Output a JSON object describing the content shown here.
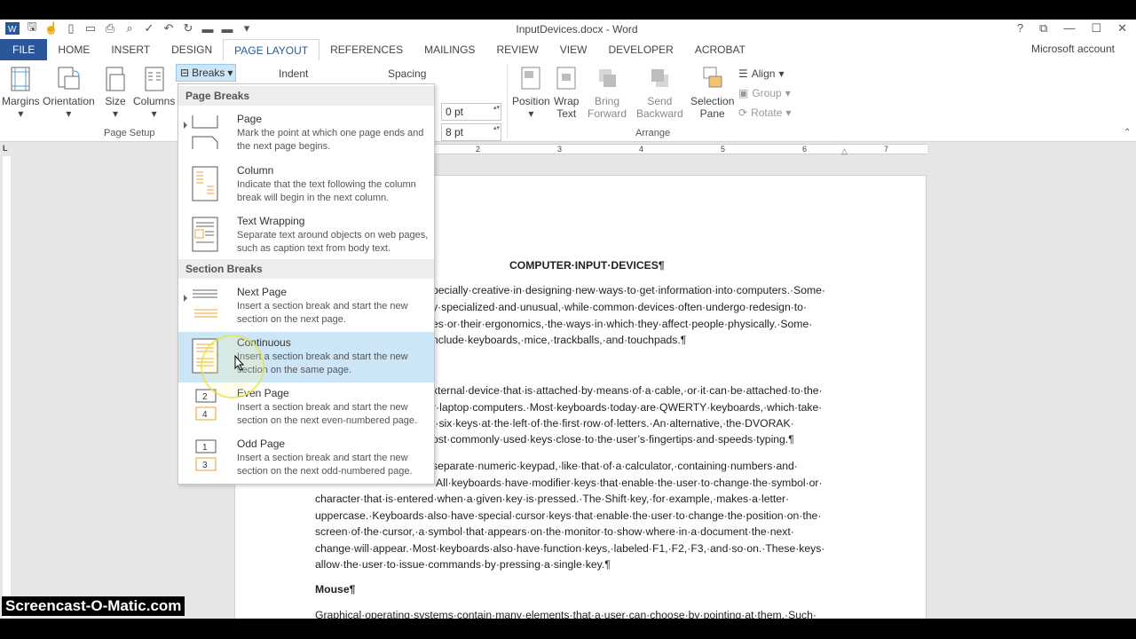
{
  "window": {
    "title": "InputDevices.docx - Word",
    "controls": [
      "?",
      "⧉",
      "—",
      "☐",
      "✕"
    ]
  },
  "tabs": [
    {
      "label": "FILE"
    },
    {
      "label": "HOME"
    },
    {
      "label": "INSERT"
    },
    {
      "label": "DESIGN"
    },
    {
      "label": "PAGE LAYOUT"
    },
    {
      "label": "REFERENCES"
    },
    {
      "label": "MAILINGS"
    },
    {
      "label": "REVIEW"
    },
    {
      "label": "VIEW"
    },
    {
      "label": "DEVELOPER"
    },
    {
      "label": "ACROBAT"
    }
  ],
  "account": "Microsoft account",
  "ribbon": {
    "page_setup": {
      "margins": "Margins",
      "orientation": "Orientation",
      "size": "Size",
      "columns": "Columns",
      "group": "Page Setup"
    },
    "breaks": "Breaks",
    "indent": "Indent",
    "spacing": {
      "label": "Spacing",
      "before": "0 pt",
      "after": "8 pt"
    },
    "arrange": {
      "position": "Position",
      "wrap_text": "Wrap\nText",
      "bring_forward": "Bring\nForward",
      "send_backward": "Send\nBackward",
      "selection_pane": "Selection\nPane",
      "align": "Align",
      "group": "Group",
      "rotate": "Rotate",
      "group_label": "Arrange"
    }
  },
  "ruler": [
    "2",
    "3",
    "4",
    "5",
    "6",
    "7"
  ],
  "dropdown": {
    "page_breaks_heading": "Page Breaks",
    "section_breaks_heading": "Section Breaks",
    "items": [
      {
        "title": "Page",
        "desc": "Mark the point at which one page ends and the next page begins."
      },
      {
        "title": "Column",
        "desc": "Indicate that the text following the column break will begin in the next column."
      },
      {
        "title": "Text Wrapping",
        "desc": "Separate text around objects on web pages, such as caption text from body text."
      },
      {
        "title": "Next Page",
        "desc": "Insert a section break and start the new section on the next page."
      },
      {
        "title": "Continuous",
        "desc": "Insert a section break and start the new section on the same page."
      },
      {
        "title": "Even Page",
        "desc": "Insert a section break and start the new section on the next even-numbered page."
      },
      {
        "title": "Odd Page",
        "desc": "Insert a section break and start the new section on the next odd-numbered page."
      }
    ]
  },
  "document": {
    "heading": "COMPUTER·INPUT·DEVICES¶",
    "p1": [
      "pecially·creative·in·designing·new·ways·to·get·information·into·computers.·Some·",
      "y·specialized·and·unusual,·while·common·devices·often·undergo·redesign·to·",
      "es·or·their·ergonomics,·the·ways·in·which·they·affect·people·physically.·Some·",
      "nclude·keyboards,·mice,·trackballs,·and·touchpads.¶"
    ],
    "p2": [
      "xternal·device·that·is·attached·by·means·of·a·cable,·or·it·can·be·attached·to·the·",
      "r·laptop·computers.·Most·keyboards·today·are·QWERTY·keyboards,·which·take·",
      "t·six·keys·at·the·left·of·the·first·row·of·letters.·An·alternative,·the·DVORAK·",
      "ost·commonly·used·keys·close·to·the·user’s·fingertips·and·speeds·typing.¶"
    ],
    "p3": [
      "separate·numeric·keypad,·like·that·of·a·calculator,·containing·numbers·and·",
      "All·keyboards·have·modifier·keys·that·enable·the·user·to·change·the·symbol·or·",
      "character·that·is·entered·when·a·given·key·is·pressed.·The·Shift·key,·for·example,·makes·a·letter·",
      "uppercase.·Keyboards·also·have·special·cursor·keys·that·enable·the·user·to·change·the·position·on·the·",
      "screen·of·the·cursor,·a·symbol·that·appears·on·the·monitor·to·show·where·in·a·document·the·next·",
      "change·will·appear.·Most·keyboards·also·have·function·keys,·labeled·F1,·F2,·F3,·and·so·on.·These·keys·",
      "allow·the·user·to·issue·commands·by·pressing·a·single·key.¶"
    ],
    "mouse_heading": "Mouse¶",
    "p4": "Graphical·operating·systems·contain·many·elements·that·a·user·can·choose·by·pointing·at·them.·Such·"
  },
  "watermark": "Screencast-O-Matic.com"
}
